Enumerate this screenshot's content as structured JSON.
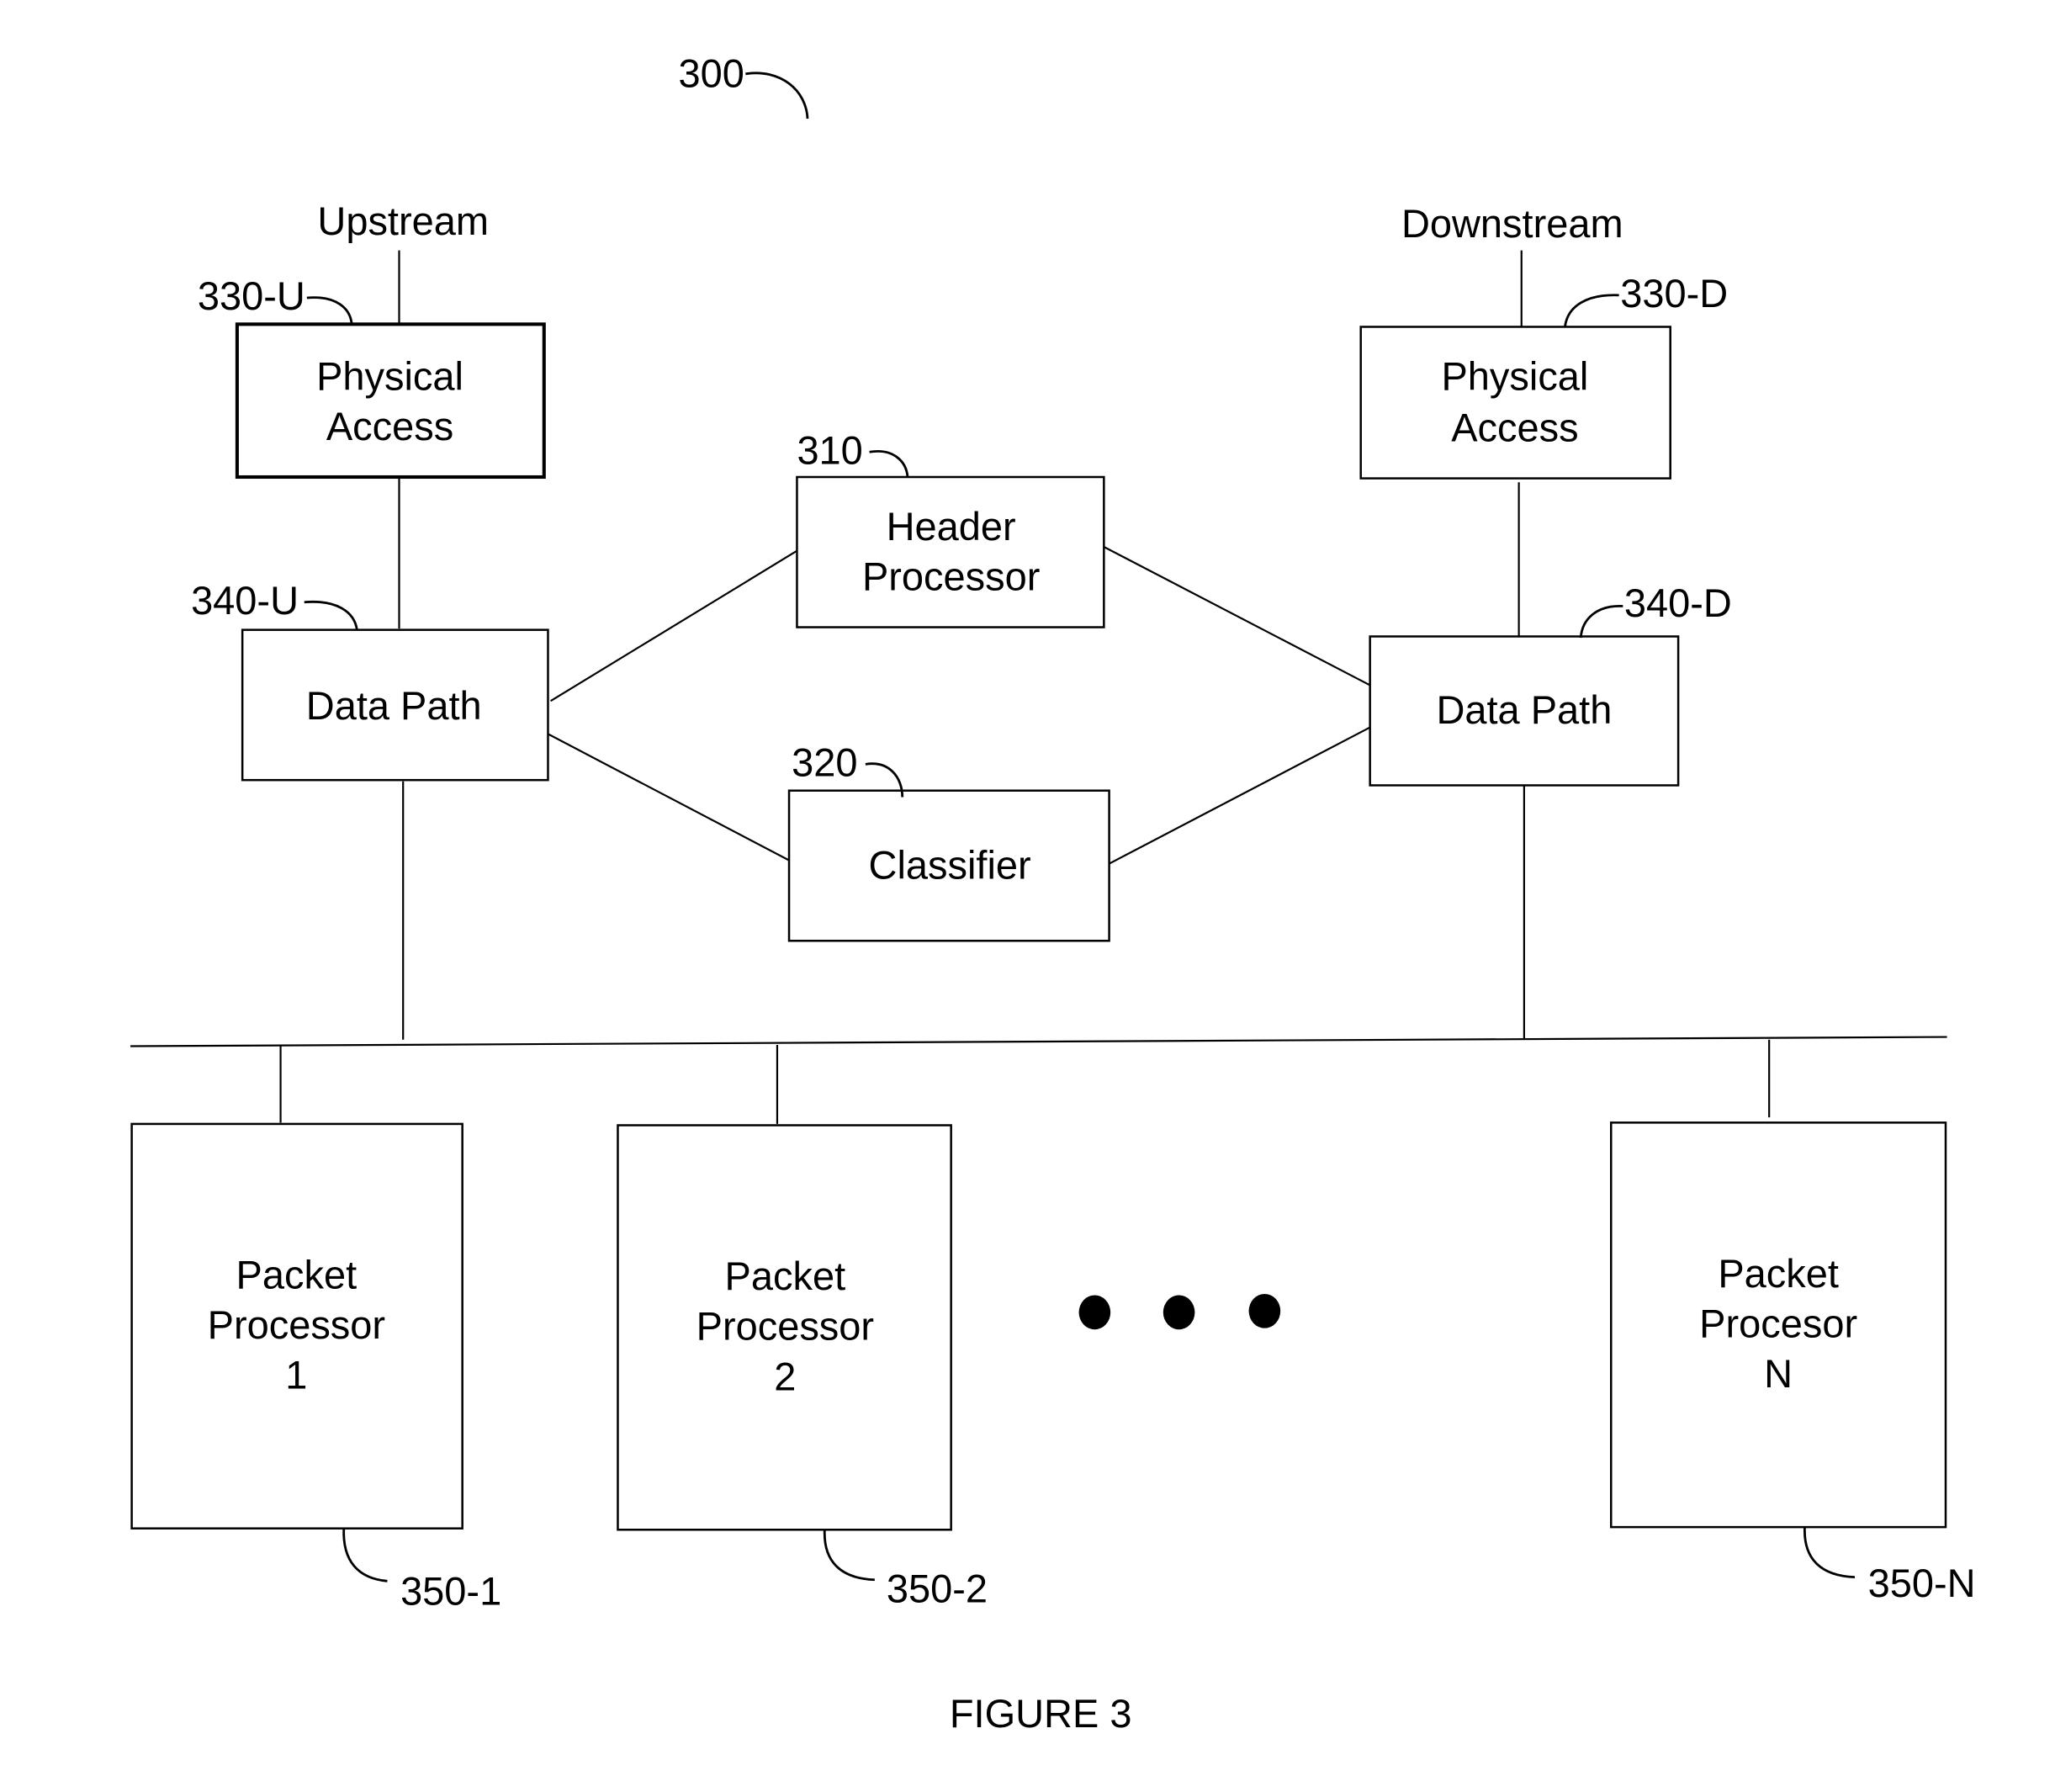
{
  "figure": {
    "ref": "300",
    "caption": "FIGURE 3"
  },
  "ports": {
    "upstream": "Upstream",
    "downstream": "Downstream"
  },
  "blocks": {
    "phys_up": {
      "ref": "330-U",
      "line1": "Physical",
      "line2": "Access"
    },
    "phys_down": {
      "ref": "330-D",
      "line1": "Physical",
      "line2": "Access"
    },
    "dp_up": {
      "ref": "340-U",
      "label": "Data Path"
    },
    "dp_down": {
      "ref": "340-D",
      "label": "Data Path"
    },
    "header": {
      "ref": "310",
      "line1": "Header",
      "line2": "Processor"
    },
    "classifier": {
      "ref": "320",
      "label": "Classifier"
    },
    "pp1": {
      "ref": "350-1",
      "line1": "Packet",
      "line2": "Processor",
      "line3": "1"
    },
    "pp2": {
      "ref": "350-2",
      "line1": "Packet",
      "line2": "Processor",
      "line3": "2"
    },
    "ppn": {
      "ref": "350-N",
      "line1": "Packet",
      "line2": "Procesor",
      "line3": "N"
    }
  },
  "ellipsis_icon": "ellipsis-dots-icon"
}
